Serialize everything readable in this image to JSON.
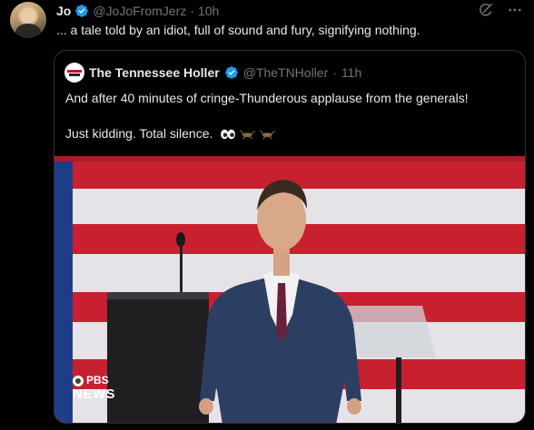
{
  "tweet": {
    "name": "Jo",
    "handle": "@JoJoFromJerz",
    "separator": "·",
    "time": "10h",
    "text": "... a tale told by an idiot, full of sound and fury, signifying nothing."
  },
  "quoted": {
    "name": "The Tennessee Holler",
    "handle": "@TheTNHoller",
    "separator": "·",
    "time": "11h",
    "line1": "And after 40 minutes of cringe-Thunderous applause from the generals!",
    "line2": "Just kidding. Total silence.",
    "emojis": [
      "eyes-emoji",
      "cricket-emoji",
      "cricket-emoji"
    ]
  },
  "media": {
    "watermark_top": "PBS",
    "watermark_bottom": "NEWS"
  },
  "colors": {
    "verified": "#1d9bf0",
    "flag_red": "#c8202f",
    "flag_blue": "#1f3c88",
    "suit": "#2c3f63"
  },
  "icons": {
    "grok": "grok-icon",
    "more": "more-icon",
    "verified": "verified-badge-icon"
  }
}
